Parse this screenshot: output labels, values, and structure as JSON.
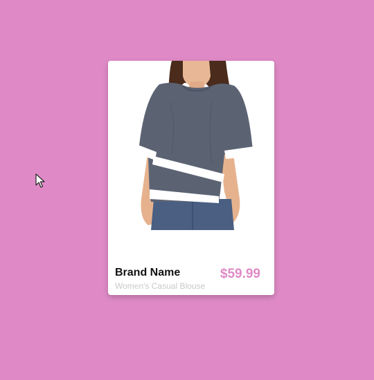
{
  "product": {
    "brand_name": "Brand Name",
    "description": "Women's Casual Blouse",
    "price": "$59.99",
    "image": {
      "garment_color": "#5b6373",
      "trim_color": "#ffffff",
      "jeans_color": "#4a5f82"
    }
  },
  "colors": {
    "background": "#df8ac6",
    "card": "#ffffff",
    "price": "#df8ac6",
    "subtitle": "#c8c8c8"
  },
  "cursor": {
    "icon": "mouse-pointer-icon"
  }
}
